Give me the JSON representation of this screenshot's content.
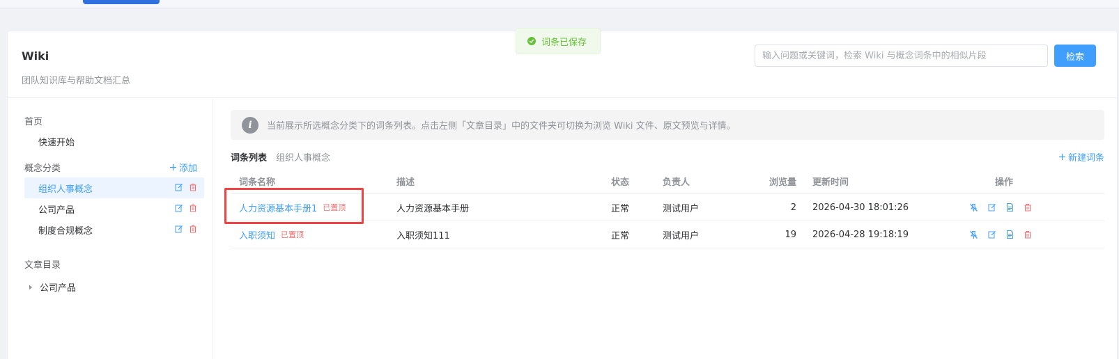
{
  "header": {
    "title": "Wiki",
    "subtitle": "团队知识库与帮助文档汇总",
    "search_placeholder": "输入问题或关键词，检索 Wiki 与概念词条中的相似片段",
    "search_button": "检索"
  },
  "toast": {
    "text": "词条已保存",
    "color": "#67c23a"
  },
  "sidebar": {
    "home_title": "首页",
    "quick_start": "快速开始",
    "concept_title": "概念分类",
    "add_label": "添加",
    "concepts": [
      {
        "label": "组织人事概念",
        "active": true
      },
      {
        "label": "公司产品",
        "active": false
      },
      {
        "label": "制度合规概念",
        "active": false
      }
    ],
    "article_title": "文章目录",
    "article_items": [
      {
        "label": "公司产品"
      }
    ]
  },
  "main": {
    "info": "当前展示所选概念分类下的词条列表。点击左侧「文章目录」中的文件夹可切换为浏览 Wiki 文件、原文预览与详情。",
    "list_title": "词条列表",
    "list_category": "组织人事概念",
    "new_entry": "新建词条",
    "columns": {
      "name": "词条名称",
      "desc": "描述",
      "status": "状态",
      "owner": "负责人",
      "views": "浏览量",
      "updated": "更新时间",
      "ops": "操作"
    },
    "rows": [
      {
        "name": "人力资源基本手册1",
        "tag": "已置顶",
        "desc": "人力资源基本手册",
        "status": "正常",
        "owner": "测试用户",
        "views": "2",
        "updated": "2026-04-30 18:01:26"
      },
      {
        "name": "入职须知",
        "tag": "已置顶",
        "desc": "入职须知111",
        "status": "正常",
        "owner": "测试用户",
        "views": "19",
        "updated": "2026-04-28 19:18:19"
      }
    ]
  },
  "colors": {
    "primary": "#409eff",
    "danger": "#f56c6c",
    "highlight": "#ef4444"
  }
}
